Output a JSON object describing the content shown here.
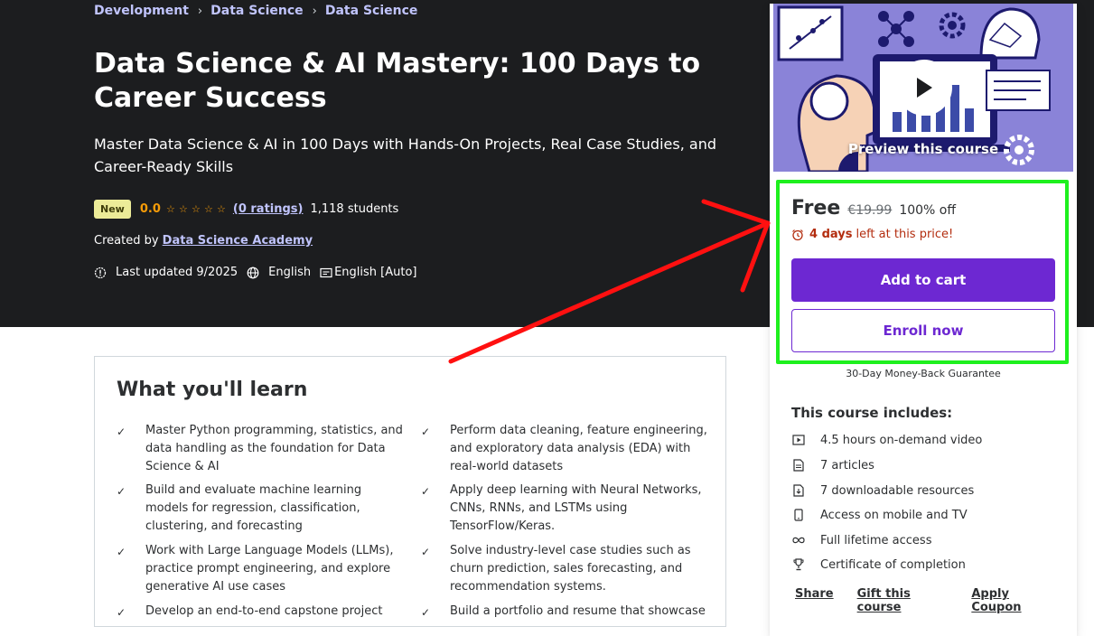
{
  "breadcrumb": [
    "Development",
    "Data Science",
    "Data Science"
  ],
  "course": {
    "title": "Data Science & AI Mastery: 100 Days to Career Success",
    "subtitle": "Master Data Science & AI in 100 Days with Hands-On Projects, Real Case Studies, and Career-Ready Skills",
    "badge": "New",
    "rating": "0.0",
    "rating_stars": 0,
    "ratings_count": "(0 ratings)",
    "students": "1,118 students",
    "created_by_label": "Created by",
    "author": "Data Science Academy",
    "last_updated": "Last updated 9/2025",
    "language": "English",
    "captions": "English [Auto]"
  },
  "learn": {
    "title": "What you'll learn",
    "items": [
      "Master Python programming, statistics, and data handling as the foundation for Data Science & AI",
      "Perform data cleaning, feature engineering, and exploratory data analysis (EDA) with real-world datasets",
      "Build and evaluate machine learning models for regression, classification, clustering, and forecasting",
      "Apply deep learning with Neural Networks, CNNs, RNNs, and LSTMs using TensorFlow/Keras.",
      "Work with Large Language Models (LLMs), practice prompt engineering, and explore generative AI use cases",
      "Solve industry-level case studies such as churn prediction, sales forecasting, and recommendation systems.",
      "Develop an end-to-end capstone project",
      "Build a portfolio and resume that showcase"
    ]
  },
  "sidebar": {
    "preview_label": "Preview this course",
    "price": "Free",
    "original_price": "€19.99",
    "discount": "100% off",
    "timer_bold": "4 days",
    "timer_rest": "left at this price!",
    "add_to_cart": "Add to cart",
    "enroll": "Enroll now",
    "guarantee": "30-Day Money-Back Guarantee",
    "includes_title": "This course includes:",
    "includes": [
      {
        "icon": "video-icon",
        "label": "4.5 hours on-demand video"
      },
      {
        "icon": "article-icon",
        "label": "7 articles"
      },
      {
        "icon": "download-icon",
        "label": "7 downloadable resources"
      },
      {
        "icon": "mobile-icon",
        "label": "Access on mobile and TV"
      },
      {
        "icon": "infinity-icon",
        "label": "Full lifetime access"
      },
      {
        "icon": "trophy-icon",
        "label": "Certificate of completion"
      }
    ],
    "links": [
      "Share",
      "Gift this course",
      "Apply Coupon"
    ]
  },
  "colors": {
    "hero_bg": "#1c1d1f",
    "link_purple": "#c0c4fc",
    "brand_purple": "#6d28d2",
    "star_orange": "#f69c08",
    "timer_red": "#b32d0f",
    "highlight_green": "#1ef01e",
    "annotation_red": "#ff0000"
  }
}
